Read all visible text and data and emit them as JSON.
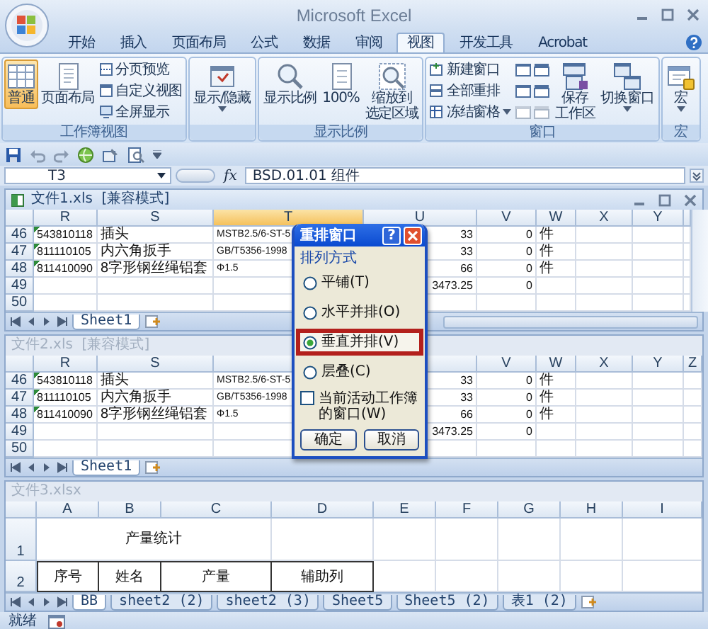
{
  "window": {
    "title": "Microsoft Excel"
  },
  "ribbon": {
    "tabs": [
      {
        "label": "开始",
        "selected": false
      },
      {
        "label": "插入",
        "selected": false
      },
      {
        "label": "页面布局",
        "selected": false
      },
      {
        "label": "公式",
        "selected": false
      },
      {
        "label": "数据",
        "selected": false
      },
      {
        "label": "审阅",
        "selected": false
      },
      {
        "label": "视图",
        "selected": true
      },
      {
        "label": "开发工具",
        "selected": false
      },
      {
        "label": "Acrobat",
        "selected": false
      }
    ],
    "groups": [
      {
        "label": "工作簿视图",
        "items": [
          {
            "kind": "large",
            "lines": [
              "普通"
            ],
            "selected": true
          },
          {
            "kind": "large",
            "lines": [
              "页面布局"
            ],
            "selected": false
          },
          {
            "kind": "stack",
            "items": [
              {
                "label": "分页预览"
              },
              {
                "label": "自定义视图"
              },
              {
                "label": "全屏显示"
              }
            ]
          }
        ]
      },
      {
        "items": [
          {
            "kind": "large",
            "lines": [
              "显示/隐藏"
            ],
            "dropdown": true
          }
        ]
      },
      {
        "label": "显示比例",
        "items": [
          {
            "kind": "large",
            "lines": [
              "显示比例"
            ]
          },
          {
            "kind": "large",
            "lines": [
              "100%"
            ]
          },
          {
            "kind": "large",
            "lines": [
              "缩放到",
              "选定区域"
            ]
          }
        ]
      },
      {
        "label": "窗口",
        "items": [
          {
            "kind": "stack",
            "items": [
              {
                "label": "新建窗口"
              },
              {
                "label": "全部重排"
              },
              {
                "label": "冻结窗格",
                "dropdown": true
              }
            ]
          },
          {
            "kind": "icons"
          },
          {
            "kind": "large",
            "lines": [
              "保存",
              "工作区"
            ]
          },
          {
            "kind": "large",
            "lines": [
              "切换窗口"
            ],
            "dropdown": true
          }
        ]
      },
      {
        "label": "宏",
        "items": [
          {
            "kind": "large",
            "lines": [
              "宏"
            ],
            "dropdown": true
          }
        ]
      }
    ]
  },
  "formula_bar": {
    "name_box": "T3",
    "function_label": "fx",
    "value": "BSD.01.01 组件"
  },
  "workbooks": [
    {
      "title": "文件1.xls  [兼容模式]",
      "active": true,
      "kind": "list",
      "columns": [
        {
          "label": "R",
          "selected": false
        },
        {
          "label": "S",
          "selected": false
        },
        {
          "label": "T",
          "selected": true
        },
        {
          "label": "U",
          "selected": false
        },
        {
          "label": "V",
          "selected": false
        },
        {
          "label": "W",
          "selected": false
        },
        {
          "label": "X",
          "selected": false
        },
        {
          "label": "Y",
          "selected": false
        }
      ],
      "rows": [
        {
          "label": "46",
          "flagged": true,
          "cells": [
            "543810118",
            "插头",
            "MSTB2.5/6-ST-5",
            "33",
            "0",
            "件"
          ]
        },
        {
          "label": "47",
          "flagged": true,
          "cells": [
            "811110105",
            "内六角扳手",
            "GB/T5356-1998",
            "33",
            "0",
            "件"
          ]
        },
        {
          "label": "48",
          "flagged": true,
          "cells": [
            "811410090",
            "8字形钢丝绳铝套",
            "Φ1.5",
            "66",
            "0",
            "件"
          ]
        },
        {
          "label": "49",
          "flagged": false,
          "cells": [
            null,
            null,
            null,
            "3473.25",
            "0"
          ]
        },
        {
          "label": "50",
          "flagged": false
        }
      ],
      "sheets": [
        {
          "label": "Sheet1",
          "selected": true
        }
      ]
    },
    {
      "title": "文件2.xls  [兼容模式]",
      "active": false,
      "kind": "list",
      "columns": [
        {
          "label": "R",
          "selected": false
        },
        {
          "label": "S",
          "selected": false
        },
        {
          "selected": false
        },
        {
          "selected": false
        },
        {
          "label": "V",
          "selected": false
        },
        {
          "label": "W",
          "selected": false
        },
        {
          "label": "X",
          "selected": false
        },
        {
          "label": "Y",
          "selected": false
        },
        {
          "label": "Z",
          "selected": false
        }
      ],
      "rows": [
        {
          "label": "46",
          "flagged": true,
          "cells": [
            "543810118",
            "插头",
            "MSTB2.5/6-ST-5",
            "33",
            "0",
            "件"
          ]
        },
        {
          "label": "47",
          "flagged": true,
          "cells": [
            "811110105",
            "内六角扳手",
            "GB/T5356-1998",
            "33",
            "0",
            "件"
          ]
        },
        {
          "label": "48",
          "flagged": true,
          "cells": [
            "811410090",
            "8字形钢丝绳铝套",
            "Φ1.5",
            "66",
            "0",
            "件"
          ]
        },
        {
          "label": "49",
          "flagged": false,
          "cells": [
            null,
            null,
            null,
            "3473.25",
            "0"
          ]
        },
        {
          "label": "50",
          "flagged": false
        }
      ],
      "sheets": [
        {
          "label": "Sheet1",
          "selected": true
        }
      ]
    },
    {
      "title": "文件3.xlsx",
      "active": false,
      "kind": "form",
      "columns": [
        {
          "label": "A",
          "selected": false
        },
        {
          "label": "B",
          "selected": false
        },
        {
          "label": "C",
          "selected": false
        },
        {
          "label": "D",
          "selected": false
        },
        {
          "label": "E",
          "selected": false
        },
        {
          "label": "F",
          "selected": false
        },
        {
          "label": "G",
          "selected": false
        },
        {
          "label": "H",
          "selected": false
        },
        {
          "label": "I",
          "selected": false
        }
      ],
      "rows": [
        {
          "label": "1",
          "title": "产量统计"
        },
        {
          "label": "2",
          "cells": [
            "序号",
            "姓名",
            "产量",
            "辅助列"
          ]
        }
      ],
      "sheets": [
        {
          "label": "BB",
          "selected": true
        },
        {
          "label": "sheet2 (2)",
          "selected": false
        },
        {
          "label": "sheet2 (3)",
          "selected": false
        },
        {
          "label": "Sheet5",
          "selected": false
        },
        {
          "label": "Sheet5 (2)",
          "selected": false
        },
        {
          "label": "表1 (2)",
          "selected": false
        }
      ]
    }
  ],
  "dialog": {
    "title": "重排窗口",
    "help_button": "?",
    "group_label": "排列方式",
    "options": [
      {
        "label": "平铺(T)",
        "selected": false
      },
      {
        "label": "水平并排(O)",
        "selected": false
      },
      {
        "label": "垂直并排(V)",
        "selected": true
      },
      {
        "label": "层叠(C)",
        "selected": false
      }
    ],
    "checkbox": {
      "label": "当前活动工作簿的窗口(W)",
      "checked": false
    },
    "buttons": [
      "确定",
      "取消"
    ]
  },
  "status_bar": {
    "text": "就绪"
  }
}
